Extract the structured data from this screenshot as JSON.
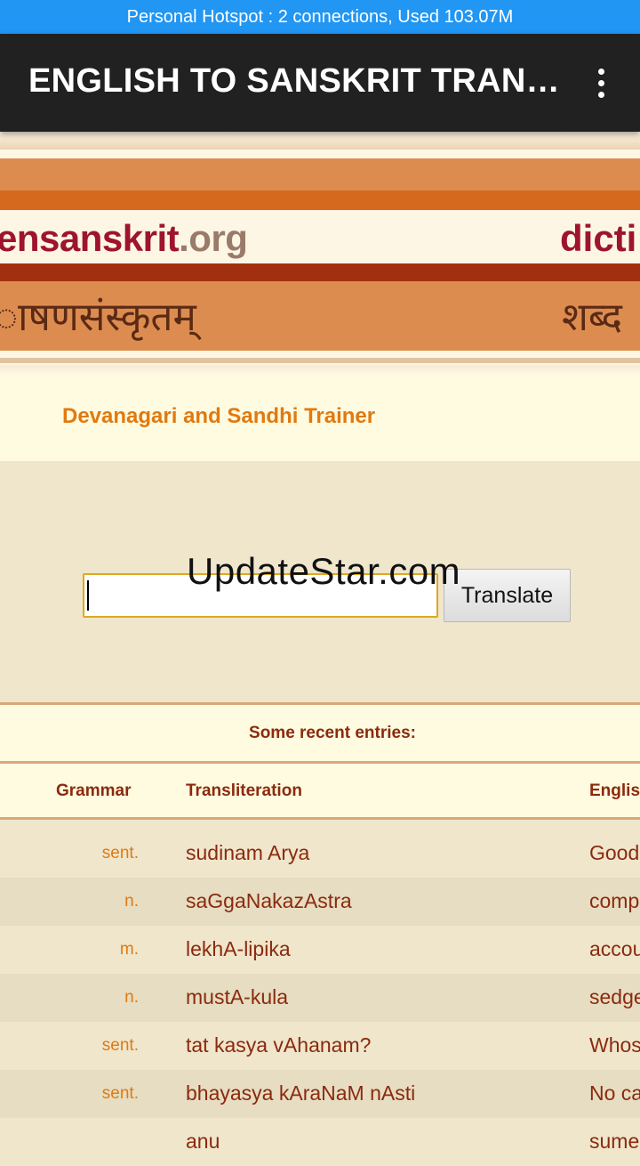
{
  "status_bar": {
    "text": "Personal Hotspot : 2 connections, Used 103.07M"
  },
  "app_bar": {
    "title": "ENGLISH TO SANSKRIT TRANS…",
    "menu_icon": "more-vert-icon"
  },
  "banner": {
    "site_name_main": "ensanskrit",
    "site_name_tld": ".org",
    "site_right": "dicti",
    "deva_left": "ाषणसंस्कृतम्",
    "deva_right": "शब्द"
  },
  "trainer": {
    "link": "Devanagari and Sandhi Trainer"
  },
  "search": {
    "value": "",
    "button_label": "Translate"
  },
  "watermark": "UpdateStar.com",
  "recent": {
    "title": "Some recent entries:",
    "columns": {
      "grammar": "Grammar",
      "transliteration": "Transliteration",
      "english": "Englis"
    },
    "rows": [
      {
        "grammar": "sent.",
        "translit": "sudinam Arya",
        "english": "Good"
      },
      {
        "grammar": "n.",
        "translit": "saGgaNakazAstra",
        "english": "comp"
      },
      {
        "grammar": "m.",
        "translit": "lekhA-lipika",
        "english": "accou"
      },
      {
        "grammar": "n.",
        "translit": "mustA-kula",
        "english": "sedge"
      },
      {
        "grammar": "sent.",
        "translit": "tat kasya vAhanam?",
        "english": "Whos"
      },
      {
        "grammar": "sent.",
        "translit": "bhayasya kAraNaM nAsti",
        "english": "No ca"
      },
      {
        "grammar": "",
        "translit": "anu",
        "english": "sume"
      }
    ]
  },
  "colors": {
    "status_bar": "#2196f3",
    "app_bar": "#212121",
    "accent_orange": "#e07a10",
    "text_maroon": "#8b2a0e",
    "site_red": "#9e1430"
  }
}
